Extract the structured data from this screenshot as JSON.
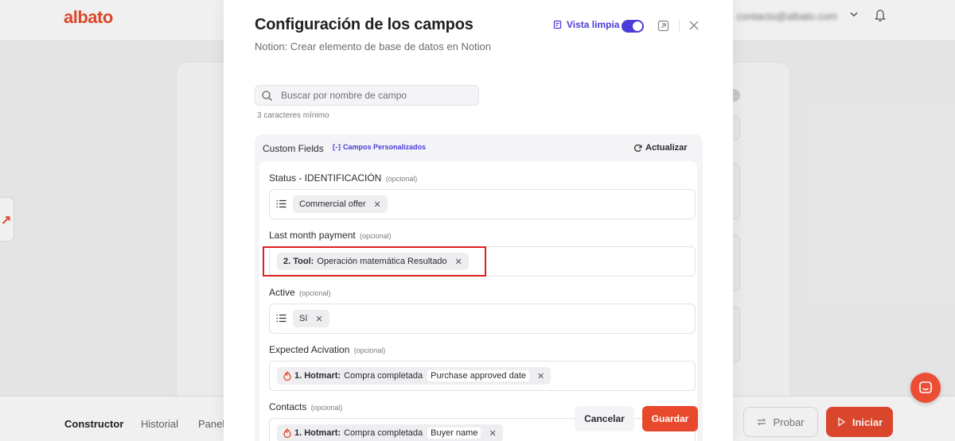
{
  "app": {
    "logo": "albato",
    "user_email": "contacto@albato.com"
  },
  "bottom_nav": {
    "items": [
      "Constructor",
      "Historial",
      "Panel"
    ],
    "probar_label": "Probar",
    "iniciar_label": "Iniciar"
  },
  "modal": {
    "title": "Configuración de los campos",
    "subtitle": "Notion: Crear elemento de base de datos en Notion",
    "clean_view_label": "Vista limpia",
    "clean_view_on": true,
    "search": {
      "placeholder": "Buscar por nombre de campo",
      "value": "",
      "hint": "3 caracteres mínimo"
    },
    "custom_fields": {
      "title": "Custom Fields",
      "badge": "Campos Personalizados",
      "refresh_label": "Actualizar"
    },
    "fields": [
      {
        "label": "Status - IDENTIFICACIÓN",
        "optional": "(opcional)",
        "chip": {
          "prefix": "",
          "text": "Commercial offer",
          "sub": ""
        }
      },
      {
        "label": "Last month payment",
        "optional": "(opcional)",
        "chip": {
          "prefix": "2. Tool:",
          "text": "Operación matemática Resultado",
          "sub": ""
        }
      },
      {
        "label": "Active",
        "optional": "(opcional)",
        "chip": {
          "prefix": "",
          "text": "Sí",
          "sub": ""
        }
      },
      {
        "label": "Expected Acivation",
        "optional": "(opcional)",
        "chip": {
          "prefix": "1. Hotmart:",
          "text": "Compra completada",
          "sub": "Purchase approved date"
        }
      },
      {
        "label": "Contacts",
        "optional": "(opcional)",
        "chip": {
          "prefix": "1. Hotmart:",
          "text": "Compra completada",
          "sub": "Buyer name"
        }
      }
    ],
    "cancel_label": "Cancelar",
    "save_label": "Guardar"
  },
  "colors": {
    "brand": "#e8492c",
    "accent": "#4b3bd8",
    "highlight": "#e01f1f"
  }
}
